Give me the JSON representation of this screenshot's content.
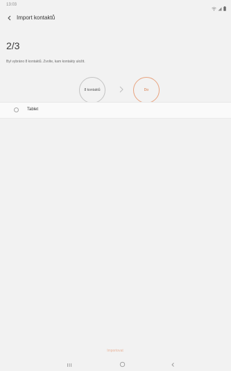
{
  "status_bar": {
    "time": "13:03",
    "icons": [
      "wifi-icon",
      "signal-icon",
      "battery-icon"
    ]
  },
  "header": {
    "back_icon": "back-arrow-icon",
    "title": "Import kontaktů"
  },
  "step": "2/3",
  "description": "Byl vybráno 8 kontaktů. Zvolte, kam kontakty uložit.",
  "flow": {
    "source_label": "8 kontaktů",
    "arrow_icon": "chevron-right-icon",
    "target_label": "Do"
  },
  "options": [
    {
      "label": "Tablet",
      "selected": false
    }
  ],
  "import_button": "Importovat",
  "nav_bar": {
    "icons": [
      "recent-apps-icon",
      "home-icon",
      "back-icon"
    ]
  },
  "colors": {
    "accent": "#e8a37f",
    "accent_text": "#d7743f",
    "background": "#f2f2f2",
    "row_background": "#fafafa"
  }
}
